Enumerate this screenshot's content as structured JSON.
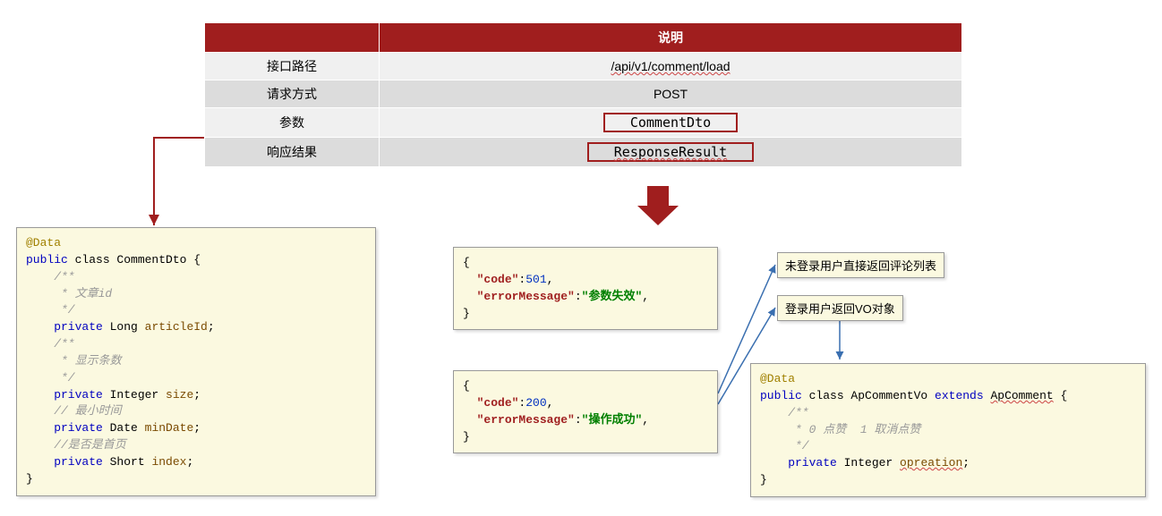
{
  "table": {
    "header_blank": "",
    "header_desc": "说明",
    "rows": [
      {
        "label": "接口路径",
        "value": "/api/v1/comment/load",
        "boxed": false
      },
      {
        "label": "请求方式",
        "value": "POST",
        "boxed": false
      },
      {
        "label": "参数",
        "value": "CommentDto",
        "boxed": true
      },
      {
        "label": "响应结果",
        "value": "ResponseResult",
        "boxed": true
      }
    ]
  },
  "commentDtoCode": {
    "ann": "@Data",
    "l1a": "public",
    "l1b": " class ",
    "l1c": "CommentDto",
    "l1d": " {",
    "c1a": "    /**",
    "c1b": "     * 文章id",
    "c1c": "     */",
    "l2a": "    private",
    "l2b": " Long ",
    "l2c": "articleId",
    "l2d": ";",
    "c2a": "    /**",
    "c2b": "     * 显示条数",
    "c2c": "     */",
    "l3a": "    private",
    "l3b": " Integer ",
    "l3c": "size",
    "l3d": ";",
    "c3": "    // 最小时间",
    "l4a": "    private",
    "l4b": " Date ",
    "l4c": "minDate",
    "l4d": ";",
    "c4": "    //是否是首页",
    "l5a": "    private",
    "l5b": " Short ",
    "l5c": "index",
    "l5d": ";",
    "end": "}"
  },
  "errBox": {
    "open": "{",
    "l1k": "\"code\"",
    "l1s": ":",
    "l1v": "501",
    "l1e": ",",
    "l2k": "\"errorMessage\"",
    "l2s": ":",
    "l2v": "\"参数失效\"",
    "l2e": ",",
    "close": "}"
  },
  "okBox": {
    "open": "{",
    "l1k": "\"code\"",
    "l1s": ":",
    "l1v": "200",
    "l1e": ",",
    "l2k": "\"errorMessage\"",
    "l2s": ":",
    "l2v": "\"操作成功\"",
    "l2e": ",",
    "close": "}"
  },
  "note1": "未登录用户直接返回评论列表",
  "note2": "登录用户返回VO对象",
  "voCode": {
    "ann": "@Data",
    "l1a": "public",
    "l1b": " class ",
    "l1c": "ApCommentVo",
    "l1d": " extends ",
    "l1e": "ApComment",
    "l1f": " {",
    "c1a": "    /**",
    "c1b": "     * 0 点赞  1 取消点赞",
    "c1c": "     */",
    "l2a": "    private",
    "l2b": " Integer ",
    "l2c": "opreation",
    "l2d": ";",
    "end": "}"
  }
}
